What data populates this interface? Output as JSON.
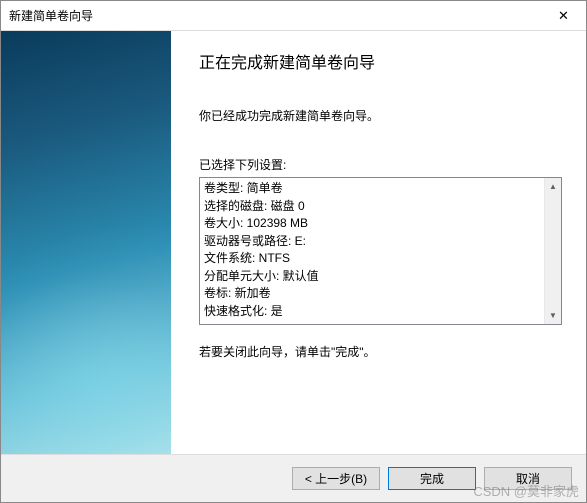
{
  "window": {
    "title": "新建简单卷向导"
  },
  "content": {
    "heading": "正在完成新建简单卷向导",
    "intro": "你已经成功完成新建简单卷向导。",
    "selected_label": "已选择下列设置:",
    "settings": [
      "卷类型: 简单卷",
      "选择的磁盘: 磁盘 0",
      "卷大小: 102398 MB",
      "驱动器号或路径: E:",
      "文件系统: NTFS",
      "分配单元大小: 默认值",
      "卷标: 新加卷",
      "快速格式化: 是"
    ],
    "closing": "若要关闭此向导，请单击\"完成\"。"
  },
  "buttons": {
    "back": "< 上一步(B)",
    "finish": "完成",
    "cancel": "取消"
  },
  "watermark": "CSDN @莫非家虎"
}
